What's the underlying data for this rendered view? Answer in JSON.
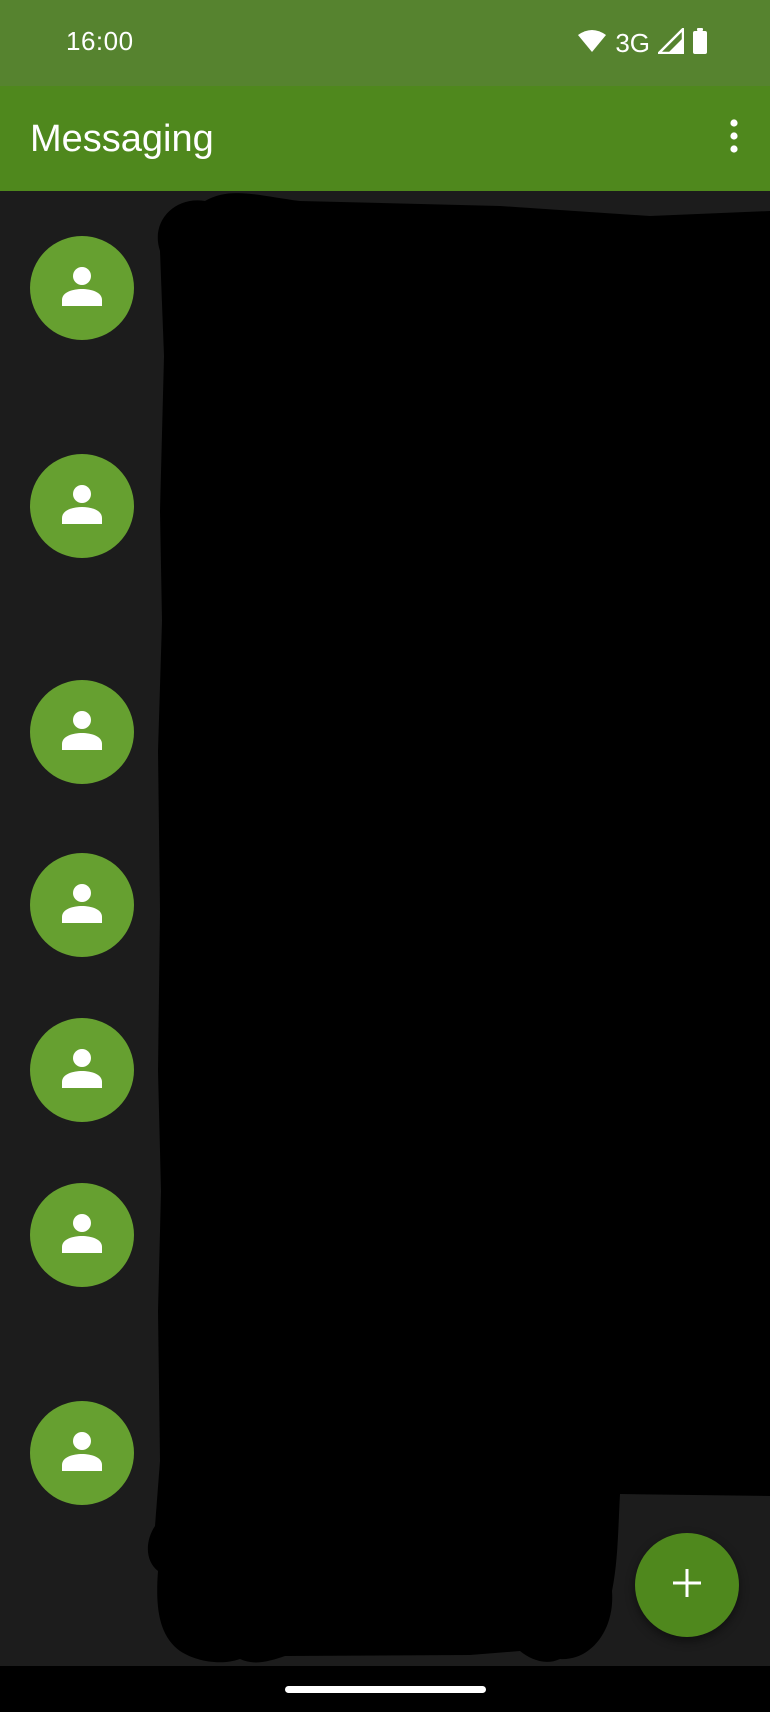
{
  "status_bar": {
    "time": "16:00",
    "network_type": "3G",
    "icons": [
      "wifi-icon",
      "cell-signal-icon",
      "battery-icon"
    ]
  },
  "app_bar": {
    "title": "Messaging",
    "overflow_icon": "more-vert-icon"
  },
  "conversations": [
    {
      "avatar_icon": "person-icon"
    },
    {
      "avatar_icon": "person-icon"
    },
    {
      "avatar_icon": "person-icon"
    },
    {
      "avatar_icon": "person-icon"
    },
    {
      "avatar_icon": "person-icon"
    },
    {
      "avatar_icon": "person-icon"
    },
    {
      "avatar_icon": "person-icon"
    }
  ],
  "fab": {
    "icon": "add-icon"
  },
  "colors": {
    "status_bar": "#56832f",
    "app_bar": "#4f881d",
    "avatar": "#66a030",
    "background": "#1c1c1c",
    "redaction": "#000000"
  }
}
